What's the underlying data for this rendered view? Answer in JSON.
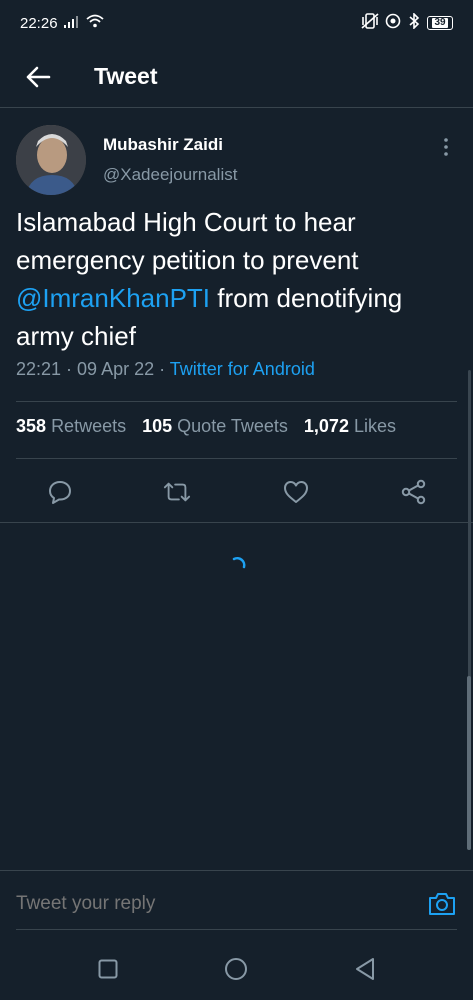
{
  "status_bar": {
    "time": "22:26",
    "battery": "39",
    "icons": [
      "signal-icon",
      "wifi-icon",
      "vibrate-icon",
      "alarm-icon",
      "bluetooth-icon",
      "battery-icon"
    ]
  },
  "header": {
    "title": "Tweet",
    "back_icon": "arrow-left-icon"
  },
  "tweet": {
    "author_name": "Mubashir Zaidi",
    "author_handle": "@Xadeejournalist",
    "text_part1": "Islamabad High Court to hear emergency petition to prevent ",
    "mention": "@ImranKhanPTI",
    "text_part2": " from denotifying army chief",
    "time": "22:21",
    "date": "09 Apr 22",
    "separator": " · ",
    "source": "Twitter for Android"
  },
  "stats": {
    "retweets_count": "358",
    "retweets_label": "Retweets",
    "quotes_count": "105",
    "quotes_label": "Quote Tweets",
    "likes_count": "1,072",
    "likes_label": "Likes"
  },
  "actions": [
    "reply-icon",
    "retweet-icon",
    "like-icon",
    "share-icon"
  ],
  "reply": {
    "placeholder": "Tweet your reply"
  },
  "colors": {
    "background": "#15202b",
    "accent": "#1da1f2",
    "secondary_text": "#8899a6",
    "divider": "#38444d"
  }
}
